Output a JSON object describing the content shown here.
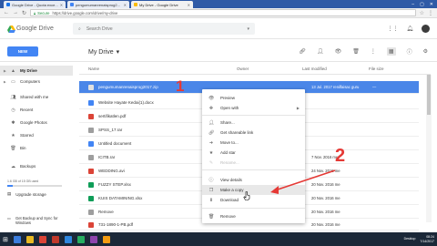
{
  "browser": {
    "tabs": [
      {
        "label": "Google Drive - Quota exce...",
        "favicon_color": "#1a73e8",
        "active": false
      },
      {
        "label": "pengumumanrenaisprog2...",
        "favicon_color": "#4285f4",
        "active": false
      },
      {
        "label": "My Drive - Google Drive",
        "favicon_color": "#fbbc05",
        "active": true
      }
    ],
    "url": "https://drive.google.com/drive/my-drive",
    "secure_label": "Secure"
  },
  "header": {
    "logo_text": "Google Drive",
    "search_placeholder": "Search Drive"
  },
  "toolbar": {
    "new_label": "NEW",
    "location_title": "My Drive"
  },
  "sidebar": {
    "items": [
      {
        "label": "My Drive",
        "icon": "drive-icon",
        "active": true
      },
      {
        "label": "Computers",
        "icon": "computer-icon",
        "active": false
      },
      {
        "label": "Shared with me",
        "icon": "people-icon",
        "active": false
      },
      {
        "label": "Recent",
        "icon": "clock-icon",
        "active": false
      },
      {
        "label": "Google Photos",
        "icon": "photos-icon",
        "active": false
      },
      {
        "label": "Starred",
        "icon": "star-icon",
        "active": false
      },
      {
        "label": "Bin",
        "icon": "bin-icon",
        "active": false
      },
      {
        "label": "Backups",
        "icon": "backup-icon",
        "active": false
      }
    ],
    "storage_text": "1.6 GB of 15 GB used",
    "storage_fraction": 0.107,
    "upgrade_label": "Upgrade storage",
    "backup_promo": "Get Backup and Sync for Windows"
  },
  "list": {
    "headers": {
      "name": "Name",
      "owner": "Owner",
      "modified": "Last modified",
      "size": "File size"
    },
    "rows": [
      {
        "name": "pengumumanrenaisprog2017.zip",
        "modified": "13 Jul. 2017 renilfaisac guru",
        "size": "—",
        "icon_color": "#9e9e9e",
        "selected": true
      },
      {
        "name": "Website Hayate Kedai(1).docx",
        "modified": "",
        "size": "",
        "icon_color": "#4285f4",
        "selected": false
      },
      {
        "name": "sertifikatlen.pdf",
        "modified": "",
        "size": "",
        "icon_color": "#db4437",
        "selected": false
      },
      {
        "name": "SPSS_17.rar",
        "modified": "",
        "size": "",
        "icon_color": "#9e9e9e",
        "selected": false
      },
      {
        "name": "Untitled document",
        "modified": "",
        "size": "",
        "icon_color": "#4285f4",
        "selected": false
      },
      {
        "name": "ICITB.rar",
        "modified": "7 Nov. 2016 me",
        "size": "",
        "icon_color": "#9e9e9e",
        "selected": false
      },
      {
        "name": "WEDDING.avi",
        "modified": "24 Nov. 2016 me",
        "size": "",
        "icon_color": "#db4437",
        "selected": false
      },
      {
        "name": "FUZZY STEP.xlsx",
        "modified": "20 Nov. 2016 me",
        "size": "",
        "icon_color": "#0f9d58",
        "selected": false
      },
      {
        "name": "Download",
        "modified": "",
        "size": "",
        "icon_color": "#9e9e9e",
        "selected": false
      },
      {
        "name": "KUIS DATAMINING.xlsx",
        "modified": "20 Nov. 2016 me",
        "size": "",
        "icon_color": "#0f9d58",
        "selected": false
      },
      {
        "name": "Remove",
        "modified": "20 Nov. 2016 me",
        "size": "",
        "icon_color": "#9e9e9e",
        "selected": false
      },
      {
        "name": "731-1890-1-PB.pdf",
        "modified": "20 Nov. 2016 me",
        "size": "",
        "icon_color": "#db4437",
        "selected": false
      }
    ]
  },
  "context_menu": {
    "items": [
      {
        "label": "Preview",
        "icon": "eye-icon",
        "submenu": false,
        "disabled": false,
        "hover": false
      },
      {
        "label": "Open with",
        "icon": "open-with-icon",
        "submenu": true,
        "disabled": false,
        "hover": false
      },
      {
        "label": "Share...",
        "icon": "share-icon",
        "submenu": false,
        "disabled": false,
        "hover": false
      },
      {
        "label": "Get shareable link",
        "icon": "link-icon",
        "submenu": false,
        "disabled": false,
        "hover": false
      },
      {
        "label": "Move to...",
        "icon": "move-icon",
        "submenu": false,
        "disabled": false,
        "hover": false
      },
      {
        "label": "Add star",
        "icon": "star-icon",
        "submenu": false,
        "disabled": false,
        "hover": false
      },
      {
        "label": "Rename...",
        "icon": "rename-icon",
        "submenu": false,
        "disabled": true,
        "hover": false
      },
      {
        "label": "View details",
        "icon": "info-icon",
        "submenu": false,
        "disabled": false,
        "hover": false
      },
      {
        "label": "Make a copy",
        "icon": "copy-icon",
        "submenu": false,
        "disabled": false,
        "hover": true
      },
      {
        "label": "Download",
        "icon": "download-icon",
        "submenu": false,
        "disabled": false,
        "hover": false
      },
      {
        "label": "Remove",
        "icon": "trash-icon",
        "submenu": false,
        "disabled": false,
        "hover": false
      }
    ]
  },
  "annotations": {
    "step1": "1",
    "step2": "2",
    "color": "#e53935"
  },
  "taskbar": {
    "label": "Desktop",
    "time": "08:24",
    "date": "7/14/2017"
  },
  "colors": {
    "selected_row": "#4a86e8",
    "new_button": "#4285f4",
    "tabbar": "#2f5aa6"
  }
}
